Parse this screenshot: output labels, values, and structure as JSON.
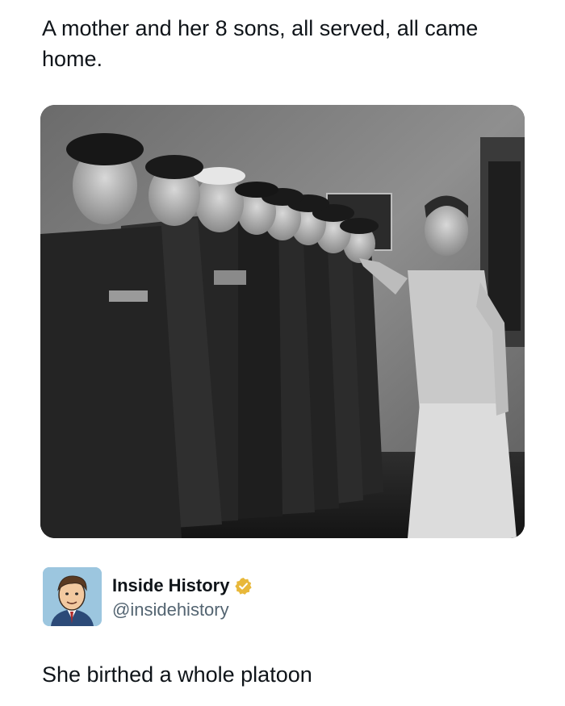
{
  "post": {
    "text": "A mother and her 8 sons, all served, all came home."
  },
  "photo": {
    "subject": "black-and-white photo of eight men in military uniforms lined up beside their mother"
  },
  "author": {
    "name": "Inside History",
    "handle": "@insidehistory",
    "verified": true,
    "verified_color": "#e8b83a",
    "avatar_icon": "cartoon-portrait-avatar"
  },
  "reply": {
    "text": "She birthed a whole platoon"
  }
}
